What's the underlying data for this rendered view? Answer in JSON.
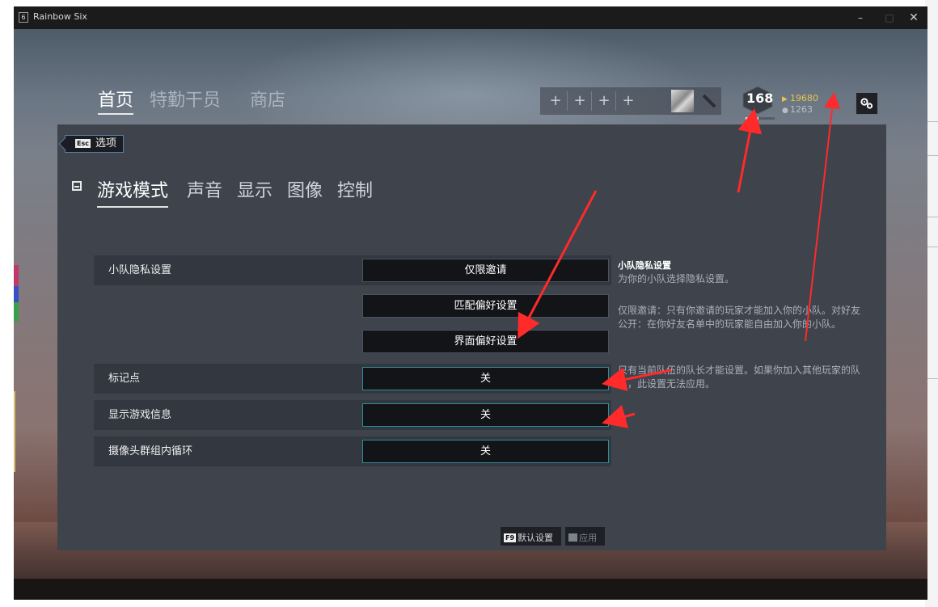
{
  "window": {
    "title": "Rainbow Six",
    "app_icon": "6",
    "controls": [
      "–",
      "□",
      "✕"
    ]
  },
  "nav": {
    "tabs": [
      "首页",
      "特勤干员",
      "商店"
    ],
    "active": 0
  },
  "squad": {
    "slots": [
      "+",
      "+",
      "+",
      "+"
    ]
  },
  "player": {
    "level": "168",
    "level_progress": 0.45,
    "renown": "19680",
    "credits": "1263"
  },
  "options": {
    "back_key": "Esc",
    "back_label": "选项",
    "tabs": [
      "游戏模式",
      "声音",
      "显示",
      "图像",
      "控制"
    ],
    "active_tab": 0
  },
  "rows": [
    {
      "label": "小队隐私设置",
      "value": "仅限邀请"
    },
    {
      "label": "",
      "value": "匹配偏好设置"
    },
    {
      "label": "",
      "value": "界面偏好设置"
    },
    {
      "label": "标记点",
      "value": "关"
    },
    {
      "label": "显示游戏信息",
      "value": "关"
    },
    {
      "label": "摄像头群组内循环",
      "value": "关"
    }
  ],
  "description": {
    "title": "小队隐私设置",
    "subtitle": "为你的小队选择隐私设置。",
    "para1": "仅限邀请：只有你邀请的玩家才能加入你的小队。对好友公开：在你好友名单中的玩家能自由加入你的小队。",
    "para2": "只有当前队伍的队长才能设置。如果你加入其他玩家的队伍，此设置无法应用。"
  },
  "footer": {
    "default_key": "F9",
    "default_label": "默认设置",
    "apply_label": "应用"
  },
  "colors": {
    "annotation_arrow": "#ff2a2a",
    "renown": "#e8c44a",
    "panel": "#3e434c"
  },
  "icons": [
    "settings-gears-icon",
    "level-hexagon-icon",
    "renown-icon",
    "credits-icon",
    "section-square-icon"
  ]
}
